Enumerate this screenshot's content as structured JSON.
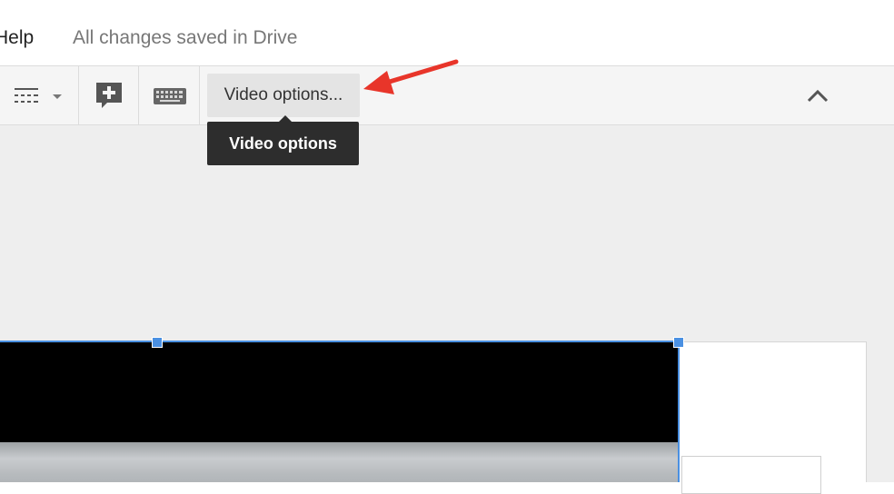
{
  "menubar": {
    "help_label": "Help",
    "save_status": "All changes saved in Drive"
  },
  "toolbar": {
    "line_spacing_icon": "line-spacing-icon",
    "insert_comment_icon": "add-comment-icon",
    "keyboard_icon": "keyboard-icon",
    "video_options_label": "Video options...",
    "collapse_icon": "chevron-up-icon"
  },
  "tooltip": {
    "text": "Video options"
  },
  "colors": {
    "selection": "#4a90e2",
    "annotation_arrow": "#e8352a",
    "tooltip_bg": "#2d2d2d",
    "toolbar_bg": "#f5f5f5",
    "canvas_bg": "#eeeeee"
  }
}
